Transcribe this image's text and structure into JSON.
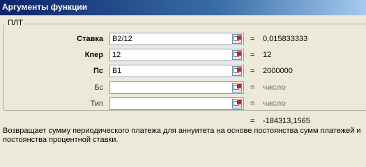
{
  "dialog": {
    "title": "Аргументы функции"
  },
  "group": {
    "label": "ПЛТ"
  },
  "args": [
    {
      "label": "Ставка",
      "value": "B2/12",
      "result": "0,015833333"
    },
    {
      "label": "Кпер",
      "value": "12",
      "result": "12"
    },
    {
      "label": "Пс",
      "value": "B1",
      "result": "2000000"
    },
    {
      "label": "Бс",
      "value": "",
      "result": "число"
    },
    {
      "label": "Тип",
      "value": "",
      "result": "число"
    }
  ],
  "equals": "=",
  "formula_result": "-184313,1565",
  "description": "Возвращает сумму периодического платежа для аннуитета на основе постоянства сумм платежей и постоянства процентной ставки."
}
